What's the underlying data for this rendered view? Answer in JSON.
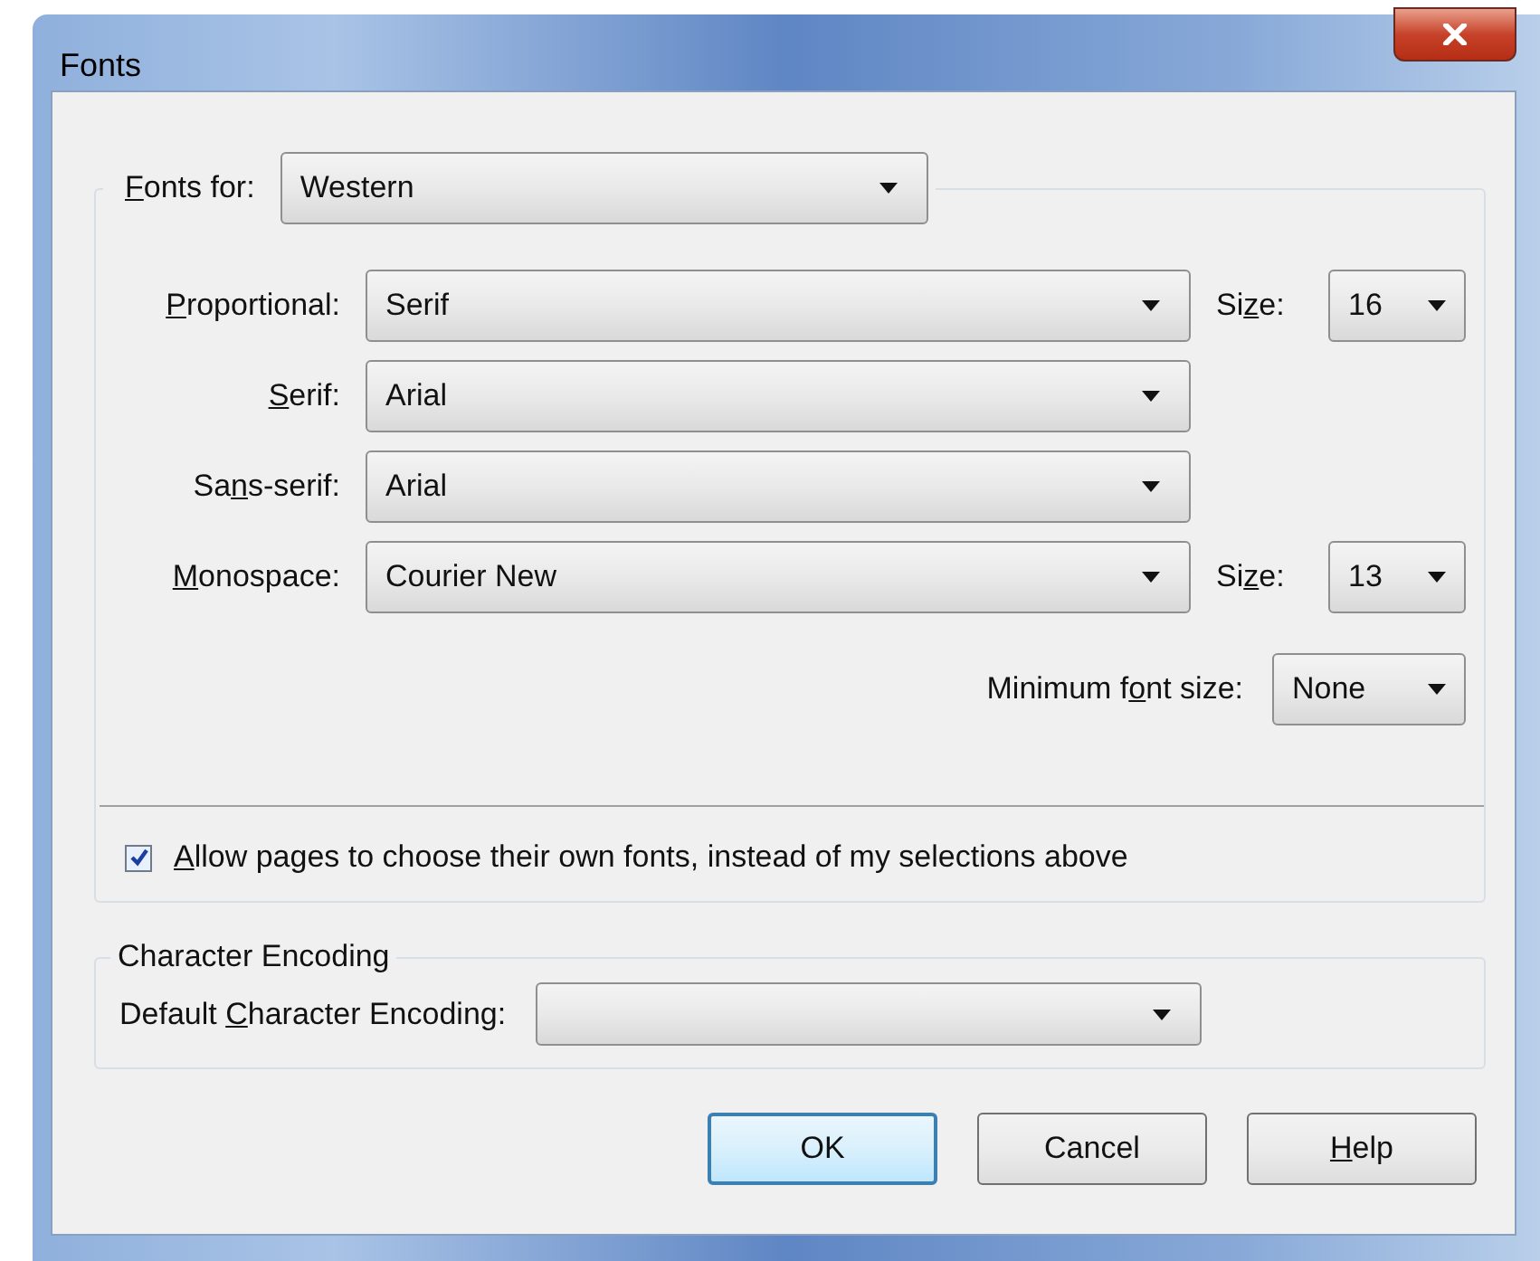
{
  "window": {
    "title": "Fonts"
  },
  "fonts_for": {
    "label": {
      "key": "F",
      "post": "onts for:"
    },
    "value": "Western"
  },
  "font_rows": [
    {
      "label": {
        "key": "P",
        "post": "roportional:"
      },
      "value": "Serif",
      "size": {
        "label": {
          "pre": "Si",
          "key": "z",
          "post": "e:"
        },
        "value": "16"
      }
    },
    {
      "label": {
        "key": "S",
        "post": "erif:"
      },
      "value": "Arial"
    },
    {
      "label": {
        "pre": "Sa",
        "key": "n",
        "post": "s-serif:"
      },
      "value": "Arial"
    },
    {
      "label": {
        "key": "M",
        "post": "onospace:"
      },
      "value": "Courier New",
      "size": {
        "label": {
          "pre": "Si",
          "key": "z",
          "post": "e:"
        },
        "value": "13"
      }
    }
  ],
  "minimum_font_size": {
    "label": {
      "pre": "Minimum f",
      "key": "o",
      "post": "nt size:"
    },
    "value": "None"
  },
  "allow_pages": {
    "label": {
      "key": "A",
      "post": "llow pages to choose their own fonts, instead of my selections above"
    },
    "checked": true
  },
  "character_encoding": {
    "title": "Character Encoding",
    "label": {
      "pre": "Default ",
      "key": "C",
      "post": "haracter Encoding:"
    }
  },
  "buttons": [
    {
      "label": {
        "pre": "OK"
      },
      "default": true
    },
    {
      "label": {
        "pre": "Cancel"
      },
      "default": false
    },
    {
      "label": {
        "key": "H",
        "post": "elp"
      },
      "default": false
    }
  ]
}
